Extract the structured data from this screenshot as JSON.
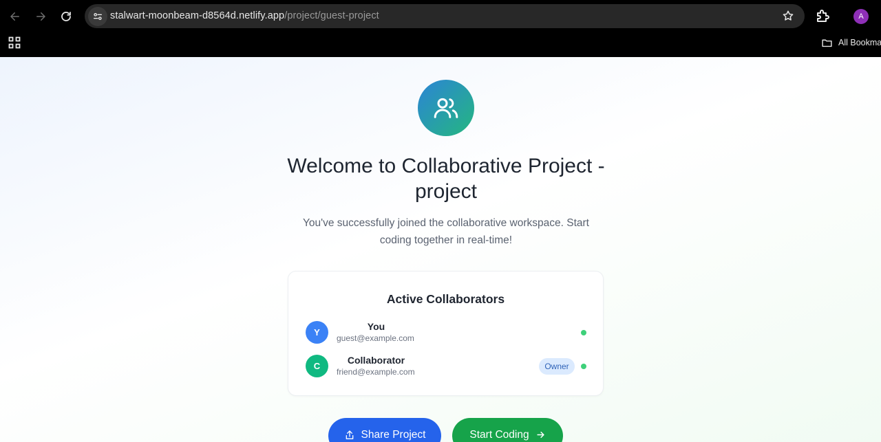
{
  "browser": {
    "url_host": "stalwart-moonbeam-d8564d.netlify.app",
    "url_path": "/project/guest-project",
    "profile_initial": "A",
    "bookmarks_label": "All Bookma"
  },
  "page": {
    "title": "Welcome to Collaborative Project - project",
    "subtitle": "You've successfully joined the collaborative workspace. Start coding together in real-time!",
    "collaborators": {
      "heading": "Active Collaborators",
      "items": [
        {
          "initial": "Y",
          "name": "You",
          "email": "guest@example.com",
          "avatar_color": "#3b82f6",
          "badge": "",
          "online": true
        },
        {
          "initial": "C",
          "name": "Collaborator",
          "email": "friend@example.com",
          "avatar_color": "#10b981",
          "badge": "Owner",
          "online": true
        }
      ]
    },
    "actions": {
      "share_label": "Share Project",
      "start_label": "Start Coding"
    }
  },
  "colors": {
    "primary_blue": "#2563eb",
    "primary_green": "#16a34a",
    "online_dot": "#3ed07a"
  }
}
